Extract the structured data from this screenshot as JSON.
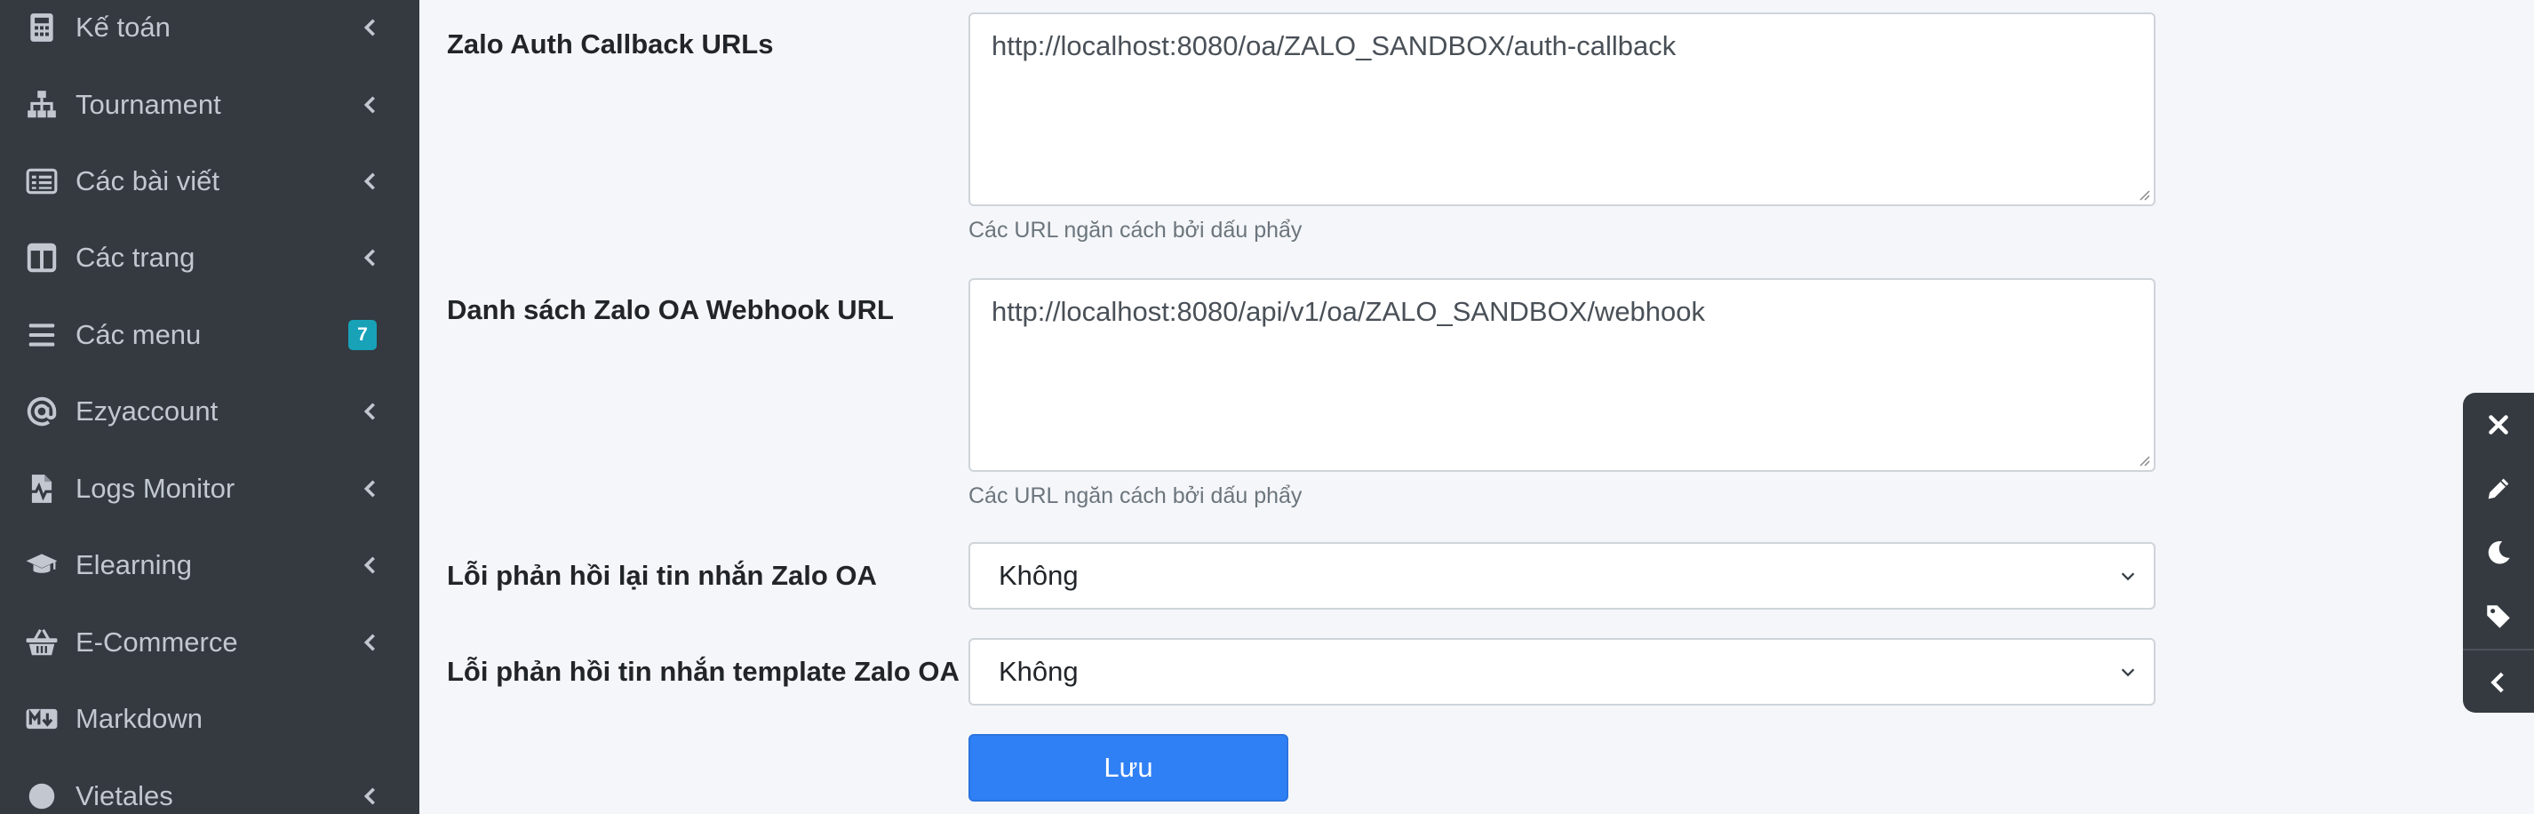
{
  "sidebar": {
    "items": [
      {
        "label": "Kế toán",
        "icon": "calculator-icon",
        "has_chevron": true
      },
      {
        "label": "Tournament",
        "icon": "sitemap-icon",
        "has_chevron": true
      },
      {
        "label": "Các bài viết",
        "icon": "list-alt-icon",
        "has_chevron": true
      },
      {
        "label": "Các trang",
        "icon": "columns-icon",
        "has_chevron": true
      },
      {
        "label": "Các menu",
        "icon": "bars-icon",
        "badge": "7"
      },
      {
        "label": "Ezyaccount",
        "icon": "at-icon",
        "has_chevron": true
      },
      {
        "label": "Logs Monitor",
        "icon": "file-medical-alt-icon",
        "has_chevron": true
      },
      {
        "label": "Elearning",
        "icon": "graduation-cap-icon",
        "has_chevron": true
      },
      {
        "label": "E-Commerce",
        "icon": "shopping-basket-icon",
        "has_chevron": true
      },
      {
        "label": "Markdown",
        "icon": "markdown-icon",
        "has_chevron": false
      },
      {
        "label": "Vietales",
        "icon": "circle-icon",
        "has_chevron": true
      }
    ],
    "text_color": "#c2c7d0",
    "background": "#343a40",
    "badge_color": "#17a2b8"
  },
  "form": {
    "auth_callback": {
      "label": "Zalo Auth Callback URLs",
      "value": "http://localhost:8080/oa/ZALO_SANDBOX/auth-callback",
      "help": "Các URL ngăn cách bởi dấu phẩy"
    },
    "webhook": {
      "label": "Danh sách Zalo OA Webhook URL",
      "value": "http://localhost:8080/api/v1/oa/ZALO_SANDBOX/webhook",
      "help": "Các URL ngăn cách bởi dấu phẩy"
    },
    "reply_error": {
      "label": "Lỗi phản hồi lại tin nhắn Zalo OA",
      "selected": "Không"
    },
    "template_error": {
      "label": "Lỗi phản hồi tin nhắn template Zalo OA",
      "selected": "Không"
    },
    "save_label": "Lưu",
    "accent": "#2f80f5"
  },
  "floating_toolbar": {
    "buttons": [
      "close-icon",
      "pencil-icon",
      "moon-icon",
      "tag-icon",
      "chevron-left-icon"
    ]
  }
}
